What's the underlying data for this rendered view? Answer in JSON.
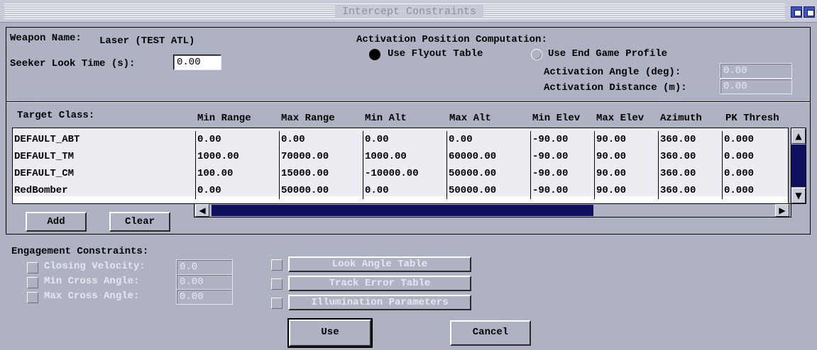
{
  "window": {
    "title": "Intercept Constraints"
  },
  "weapon": {
    "name_label": "Weapon Name:",
    "name_value": "Laser (TEST ATL)",
    "seeker_label": "Seeker Look Time (s):",
    "seeker_value": "0.00"
  },
  "activation": {
    "heading": "Activation Position Computation:",
    "option_flyout": "Use Flyout Table",
    "option_endgame": "Use End Game Profile",
    "selected": "Use Flyout Table",
    "angle_label": "Activation Angle (deg):",
    "angle_value": "0.00",
    "distance_label": "Activation Distance (m):",
    "distance_value": "0.00"
  },
  "table": {
    "columns": [
      "Target Class:",
      "Min Range",
      "Max Range",
      "Min Alt",
      "Max Alt",
      "Min Elev",
      "Max Elev",
      "Azimuth",
      "PK Thresh"
    ],
    "rows": [
      [
        "DEFAULT_ABT",
        "0.00",
        "0.00",
        "0.00",
        "0.00",
        "-90.00",
        "90.00",
        "360.00",
        "0.000"
      ],
      [
        "DEFAULT_TM",
        "1000.00",
        "70000.00",
        "1000.00",
        "60000.00",
        "-90.00",
        "90.00",
        "360.00",
        "0.000"
      ],
      [
        "DEFAULT_CM",
        "100.00",
        "15000.00",
        "-10000.00",
        "50000.00",
        "-90.00",
        "90.00",
        "360.00",
        "0.000"
      ],
      [
        "RedBomber",
        "0.00",
        "50000.00",
        "0.00",
        "50000.00",
        "-90.00",
        "90.00",
        "360.00",
        "0.000"
      ]
    ],
    "add_label": "Add",
    "clear_label": "Clear"
  },
  "engagement": {
    "heading": "Engagement Constraints:",
    "closing_label": "Closing Velocity:",
    "closing_value": "0.0",
    "min_cross_label": "Min Cross Angle:",
    "min_cross_value": "0.00",
    "max_cross_label": "Max Cross Angle:",
    "max_cross_value": "0.00",
    "look_angle_label": "Look Angle Table",
    "track_error_label": "Track Error Table",
    "illumination_label": "Illumination Parameters"
  },
  "actions": {
    "use_label": "Use",
    "cancel_label": "Cancel"
  }
}
